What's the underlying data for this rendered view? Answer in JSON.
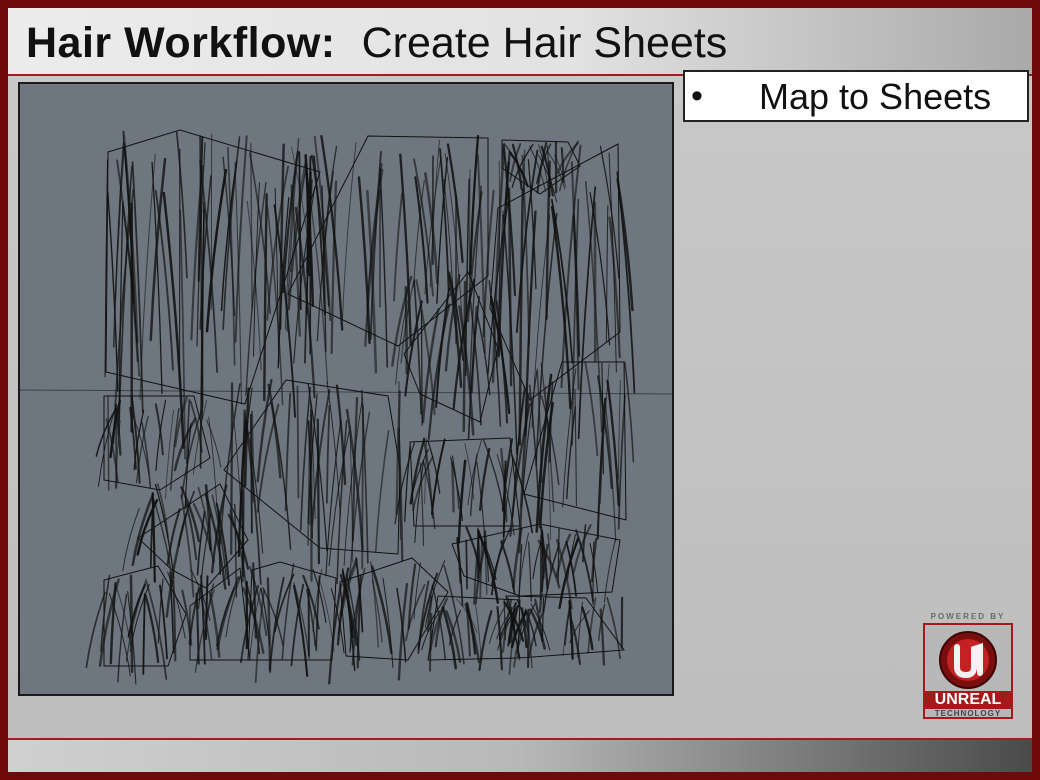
{
  "slide": {
    "title_bold": "Hair Workflow:",
    "title_rest": "Create Hair Sheets",
    "bullet_symbol": "•",
    "bullet_text": "Map to Sheets"
  },
  "logo": {
    "powered_by": "POWERED BY",
    "brand": "UNREAL",
    "subtitle": "TECHNOLOGY",
    "accent_color": "#a21a1a"
  },
  "texture": {
    "background_color": "#6e777f",
    "stroke_color": "#111111"
  }
}
